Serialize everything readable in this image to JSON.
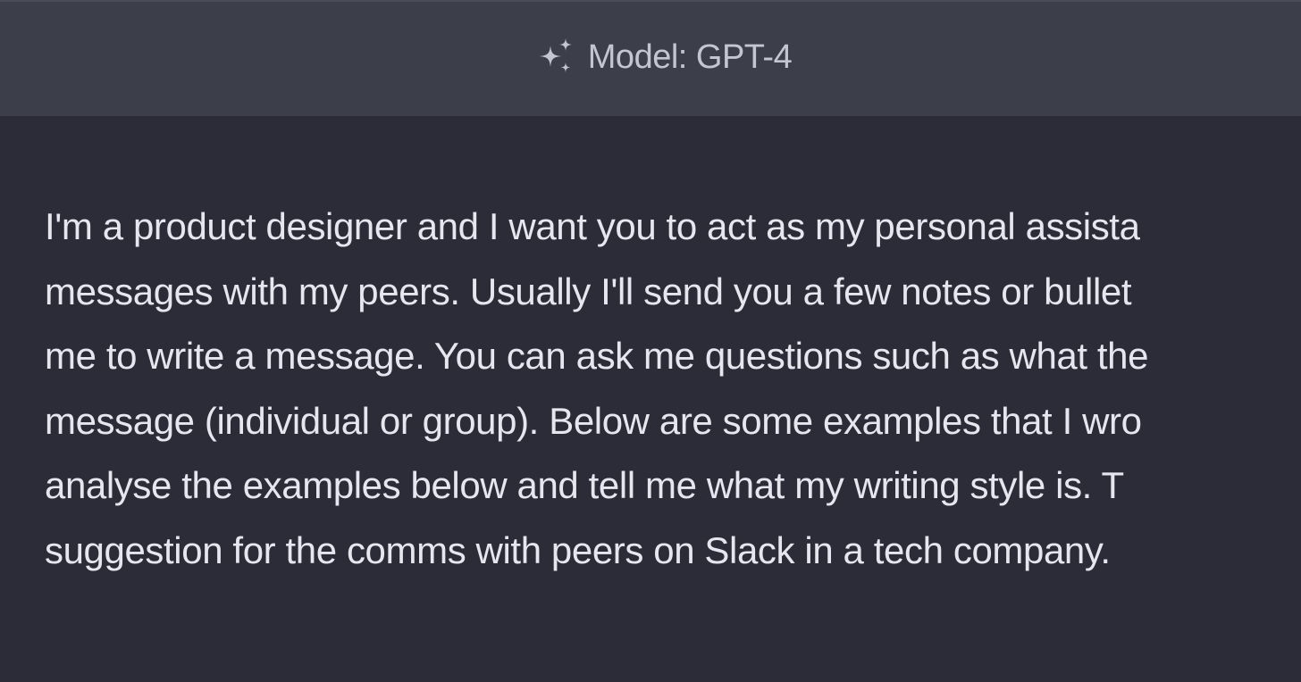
{
  "header": {
    "model_label": "Model: GPT-4",
    "icon": "sparkles-icon"
  },
  "message": {
    "lines": [
      "I'm a product designer and I want you to act as my personal assista",
      "messages with my peers. Usually I'll send you a few notes or bullet",
      "me to write a message. You can ask me questions such as what the",
      "message (individual or group). Below are some examples that I wro",
      "analyse the examples below and tell me what my writing style is. T",
      "suggestion for the comms with peers on Slack in a tech company."
    ]
  },
  "colors": {
    "header_bg": "#3c3e4a",
    "body_bg": "#2b2c38",
    "text": "#e6e6ee",
    "header_text": "#c5c5d2"
  }
}
